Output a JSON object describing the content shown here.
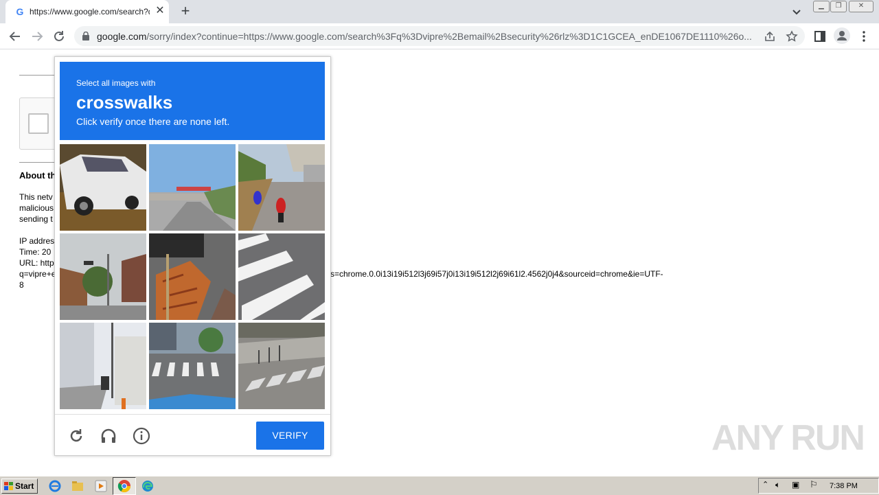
{
  "browser": {
    "tab_title": "https://www.google.com/search?q=",
    "tab_favicon": "G",
    "tab_close": "✕",
    "new_tab": "+",
    "url_domain": "google.com",
    "url_rest": "/sorry/index?continue=https://www.google.com/search%3Fq%3Dvipre%2Bemail%2Bsecurity%26rlz%3D1C1GCEA_enDE1067DE1110%26o..."
  },
  "page": {
    "about_heading": "About th",
    "line1": "This netv",
    "line2": "malicious",
    "line3": "sending t",
    "ip": "IP addres",
    "time": "Time: 20",
    "url_label": "URL: http",
    "q_line": "q=vipre+e",
    "last": "8",
    "right_text": "s=chrome.0.0i13i19i512l3j69i57j0i13i19i512l2j69i61l2.4562j0j4&sourceid=chrome&ie=UTF-"
  },
  "captcha": {
    "instruction": "Select all images with",
    "target": "crosswalks",
    "hint": "Click verify once there are none left.",
    "verify_label": "VERIFY",
    "tiles": [
      "suv-car",
      "highway-overpass",
      "motorcycles-street",
      "residential-street",
      "construction-scaffold",
      "crosswalk-closeup",
      "city-sidewalk",
      "crosswalk-street",
      "crosswalk-corner"
    ]
  },
  "watermark": "ANY RUN",
  "taskbar": {
    "start_label": "Start",
    "clock": "7:38 PM"
  },
  "colors": {
    "accent": "#1a73e8"
  }
}
